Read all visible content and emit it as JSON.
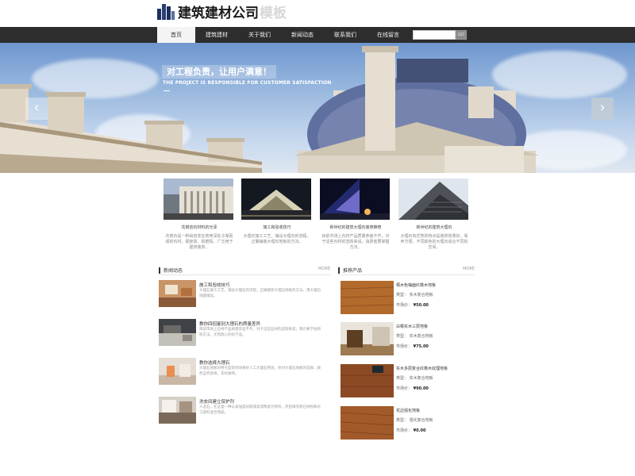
{
  "logo": {
    "name": "建筑建材公司",
    "sub": "模板"
  },
  "nav": {
    "items": [
      "首页",
      "建筑建材",
      "关于我们",
      "新闻动态",
      "联系我们",
      "在线留言"
    ],
    "search_placeholder": "",
    "search_button": "GO"
  },
  "banner": {
    "slogan": "对工程负责，让用户满意！",
    "slogan_en": "THE PROJECT IS RESPONSIBLE FOR CUSTOMER SATISFACTION",
    "prev_arrow": "‹",
    "next_arrow": "›"
  },
  "features": [
    {
      "title": "花岗岩石材料的光泽",
      "desc": "花岗石是一种由岩浆在地壳深处冷凝而成的石材，硬度高、耐磨损，广泛用于建筑装饰。"
    },
    {
      "title": "施工和验收技巧",
      "desc": "大理石施工工艺，铺设大理石的流程，正确铺装大理石地板的方法。"
    },
    {
      "title": "新世纪的建筑大理石装修推荐",
      "desc": "目前市场上石材产品质量参差不齐，对于这些石材的选购来说，消费者要掌握方法。"
    },
    {
      "title": "新世纪的建筑大理石",
      "desc": "大理石有优势的特点是装饰效果好，保养方便，不同颜色的大理石适合不同的空间。"
    }
  ],
  "news": {
    "title": "新闻动态",
    "more": "MORE",
    "items": [
      {
        "title": "施工和验收技巧",
        "desc": "大理石施工工艺，铺设大理石的流程，正确铺装大理石地板的方法，用大理石地面铺设。"
      },
      {
        "title": "教你四招鉴别大理石的质量差异",
        "desc": "目前市场上石材产品质量参差不齐，对于这些石材的选购来说，我们要学会辨别方法，买到放心的好产品。"
      },
      {
        "title": "教你选择大理石",
        "desc": "大理石地板的特点是装饰效果好人工大理石用途，你对大理石地板的选择，颜色自然多样，花纹独特。"
      },
      {
        "title": "洗衣间建立保护剂",
        "desc": "人造石，在这里一种以高强度树脂或高温陶瓷为原料，然后填充原石材粉和化工颜料混合而成。"
      }
    ]
  },
  "products": {
    "title": "推荐产品",
    "more": "MORE",
    "items": [
      {
        "title": "桐木色柚面红橡木地板",
        "type": "实木复合地板",
        "price": "¥50.00"
      },
      {
        "title": "白橡实木三层地板",
        "type": "实木复合地板",
        "price": "¥75.00"
      },
      {
        "title": "实木多层复合红橡木纹理地板",
        "type": "实木复合地板",
        "price": "¥90.00"
      },
      {
        "title": "花边强化地板",
        "type": "强化复合地板",
        "price": "¥0.00"
      }
    ],
    "type_label": "类型：",
    "price_label": "市场价："
  },
  "colors": {
    "nav_bg": "#2d2d2d",
    "logo": "#1d2f5c"
  }
}
